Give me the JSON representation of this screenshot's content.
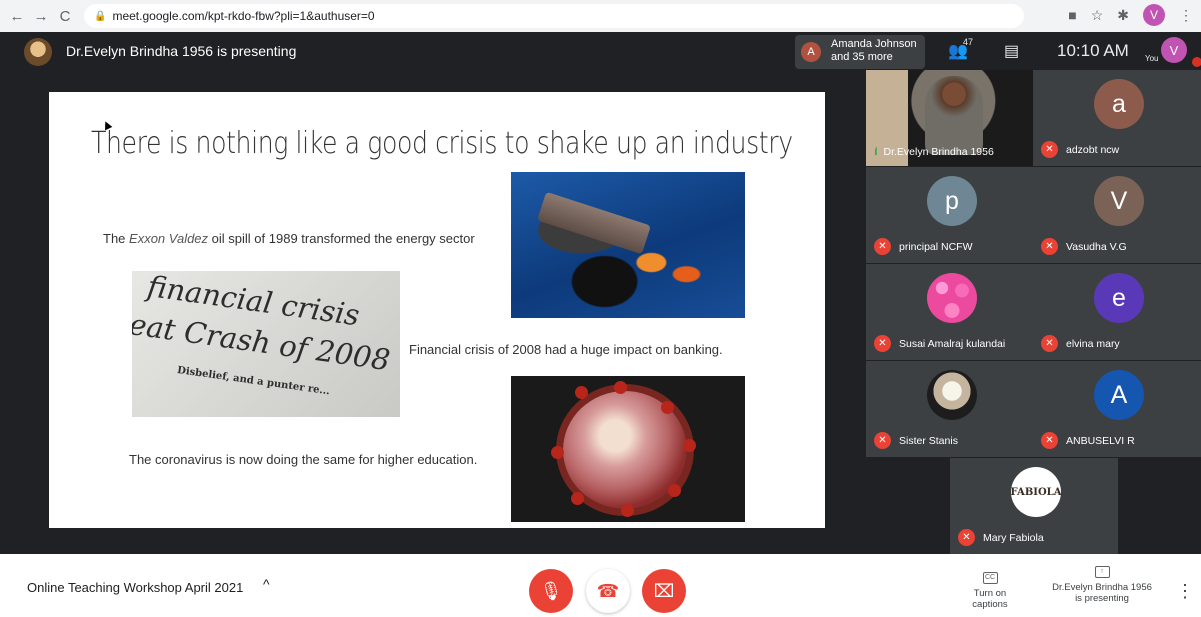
{
  "browser": {
    "back": "←",
    "forward": "→",
    "reload": "C",
    "lock": "🔒",
    "url": "meet.google.com/kpt-rkdo-fbw?pli=1&authuser=0",
    "camera": "■",
    "star": "☆",
    "extensions": "✱",
    "profile": "V",
    "menu": "⋮"
  },
  "meet": {
    "presenting_title": "Dr.Evelyn Brindha 1956 is presenting",
    "attendee_avatar": "A",
    "attendee_text": "Amanda Johnson and 35 more",
    "people_icon": "👥",
    "people_count": "47",
    "chat_icon": "▤",
    "time": "10:10 AM",
    "self_avatar": "V",
    "you": "You"
  },
  "slide": {
    "title": "There is nothing like a good crisis to shake up an industry",
    "exxon_prefix": "The",
    "exxon_italic": "Exxon Valdez",
    "exxon_suffix": "oil spill of 1989 transformed the energy sector",
    "financial": "Financial crisis of 2008 had a huge impact on banking.",
    "coronavirus": "The coronavirus is now doing the same for higher education.",
    "newspaper": {
      "line1": "financial crisis",
      "line2": "eat Crash of 2008",
      "line3": "Disbelief, and a punter re..."
    }
  },
  "participants": [
    {
      "name": "Dr.Evelyn Brindha 1956",
      "avatar": "",
      "type": "video",
      "mic": "speaking"
    },
    {
      "name": "adzobt ncw",
      "avatar": "a",
      "color": "#8d5b4c",
      "type": "initial",
      "mic": "muted"
    },
    {
      "name": "principal NCFW",
      "avatar": "p",
      "color": "#6f8794",
      "type": "initial",
      "mic": "muted"
    },
    {
      "name": "Vasudha V.G",
      "avatar": "V",
      "color": "#7b6256",
      "type": "initial",
      "mic": "muted"
    },
    {
      "name": "Susai Amalraj kulandai",
      "avatar": "",
      "type": "flower",
      "mic": "muted"
    },
    {
      "name": "elvina mary",
      "avatar": "e",
      "color": "#5a39b8",
      "type": "initial",
      "mic": "muted"
    },
    {
      "name": "Sister Stanis",
      "avatar": "",
      "type": "photo",
      "mic": "muted"
    },
    {
      "name": "ANBUSELVI R",
      "avatar": "A",
      "color": "#1557b0",
      "type": "initial",
      "mic": "muted"
    },
    {
      "name": "Mary Fabiola",
      "avatar": "FABIOLA",
      "type": "logo",
      "mic": "muted"
    }
  ],
  "bottom": {
    "meeting_title": "Online Teaching Workshop April 2021",
    "chevron": "^",
    "mic_icon": "🎙",
    "end_icon": "☎",
    "camera_icon": "⌧",
    "captions_icon": "CC",
    "captions_label": "Turn on captions",
    "present_icon": "↑",
    "present_label_1": "Dr.Evelyn Brindha 1956",
    "present_label_2": "is presenting",
    "more": "⋮"
  }
}
